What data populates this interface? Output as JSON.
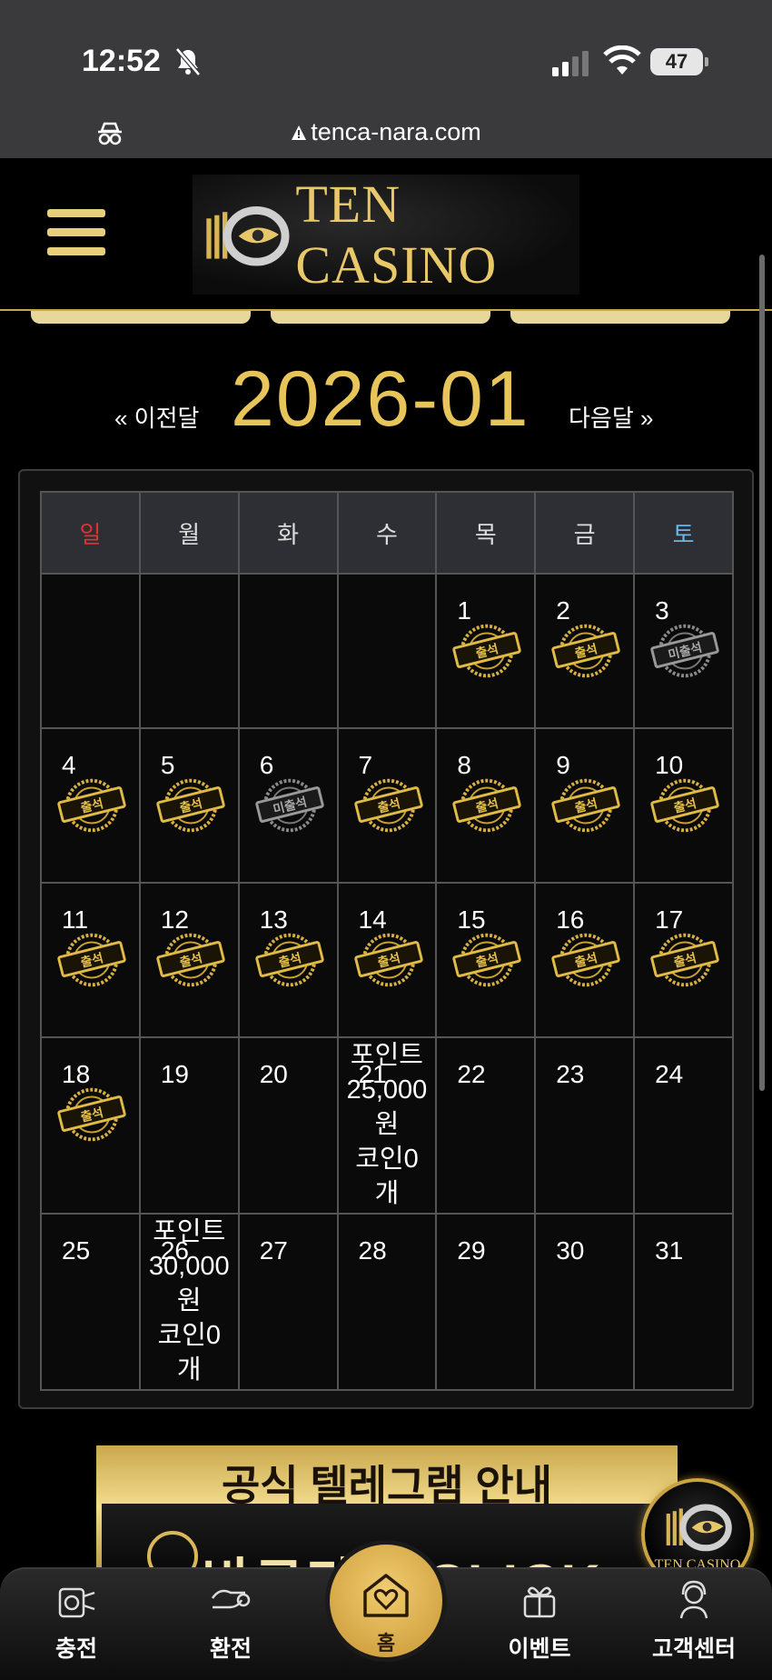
{
  "status_bar": {
    "time": "12:52",
    "battery": "47"
  },
  "browser": {
    "url": "tenca-nara.com"
  },
  "site": {
    "logo_text": "TEN CASINO"
  },
  "calendar": {
    "prev_label": "« 이전달",
    "month": "2026-01",
    "next_label": "다음달 »",
    "weekdays": [
      "일",
      "월",
      "화",
      "수",
      "목",
      "금",
      "토"
    ],
    "stamps": {
      "attended": "출석",
      "missed": "미출석"
    },
    "days": {
      "d1": "1",
      "d2": "2",
      "d3": "3",
      "d4": "4",
      "d5": "5",
      "d6": "6",
      "d7": "7",
      "d8": "8",
      "d9": "9",
      "d10": "10",
      "d11": "11",
      "d12": "12",
      "d13": "13",
      "d14": "14",
      "d15": "15",
      "d16": "16",
      "d17": "17",
      "d18": "18",
      "d19": "19",
      "d20": "20",
      "d21": "21",
      "d22": "22",
      "d23": "23",
      "d24": "24",
      "d25": "25",
      "d26": "26",
      "d27": "27",
      "d28": "28",
      "d29": "29",
      "d30": "30",
      "d31": "31"
    },
    "rewards": {
      "d21": [
        "포인트",
        "25,000",
        "원",
        "코인0",
        "개"
      ],
      "d26": [
        "포인트",
        "30,000",
        "원",
        "코인0",
        "개"
      ]
    }
  },
  "banner": {
    "title": "공식 텔레그램 안내",
    "subtitle": "바로가기 CLICK"
  },
  "floating_logo": "TEN CASINO",
  "bottom_nav": {
    "charge": "충전",
    "exchange": "환전",
    "home": "홈",
    "event": "이벤트",
    "support": "고객센터"
  }
}
